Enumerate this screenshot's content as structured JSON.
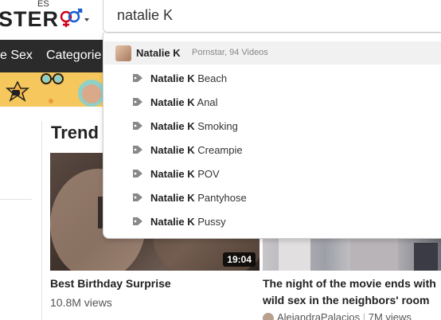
{
  "header": {
    "logo_text": "STER",
    "language": "ES",
    "search_value": "natalie K"
  },
  "nav": {
    "items": [
      "e Sex",
      "Categorie"
    ]
  },
  "dropdown": {
    "pornstar": {
      "name": "Natalie K",
      "meta": "Pornstar, 94 Videos"
    },
    "suggestions": [
      {
        "prefix": "Natalie K",
        "suffix": " Beach"
      },
      {
        "prefix": "Natalie K",
        "suffix": " Anal"
      },
      {
        "prefix": "Natalie K",
        "suffix": " Smoking"
      },
      {
        "prefix": "Natalie K",
        "suffix": " Creampie"
      },
      {
        "prefix": "Natalie K",
        "suffix": " POV"
      },
      {
        "prefix": "Natalie K",
        "suffix": " Pantyhose"
      },
      {
        "prefix": "Natalie K",
        "suffix": " Pussy"
      }
    ]
  },
  "main": {
    "section_title": "Trend",
    "videos": [
      {
        "title": "Best Birthday Surprise",
        "views": "10.8M views",
        "duration": "19:04"
      },
      {
        "title_line1": "The night of the movie ends with",
        "title_line2": "wild sex in the neighbors' room",
        "uploader": "AlejandraPalacios",
        "views": "7M views"
      }
    ]
  },
  "colors": {
    "nav_bg": "#2b2b2b",
    "banner_bg": "#f6c75c",
    "gender_icon": "#d0021b"
  }
}
